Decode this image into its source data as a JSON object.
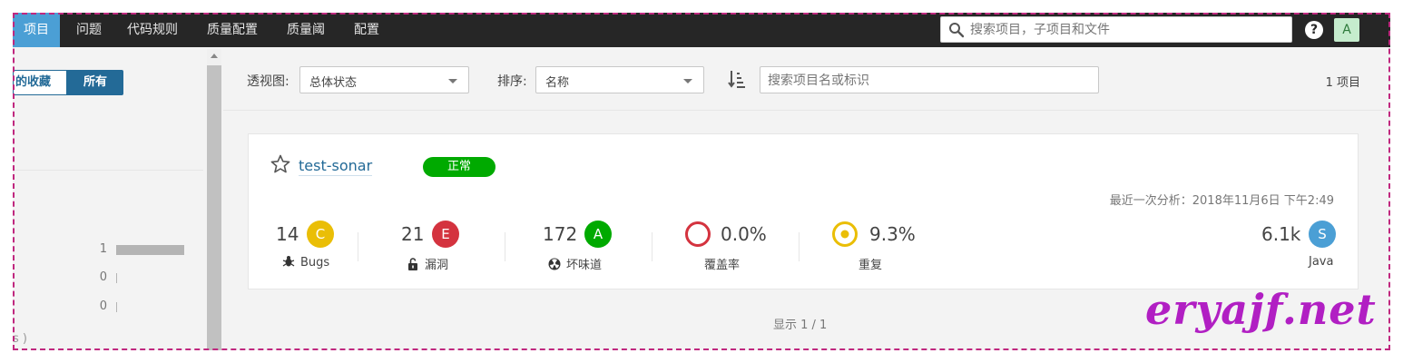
{
  "nav": {
    "items": [
      {
        "label": "项目",
        "active": true
      },
      {
        "label": "问题"
      },
      {
        "label": "代码规则"
      },
      {
        "label": "质量配置"
      },
      {
        "label": "质量阈"
      },
      {
        "label": "配置"
      }
    ],
    "search_placeholder": "搜索项目，子项目和文件",
    "help": "?",
    "avatar": "A"
  },
  "sidebar": {
    "favorites_label": "的收藏",
    "all_label": "所有",
    "facet_counts": [
      "1",
      "0",
      "0"
    ],
    "facet_fill": [
      1,
      0,
      0
    ],
    "cut_text": "s )"
  },
  "toolbar": {
    "perspective_label": "透视图:",
    "perspective_value": "总体状态",
    "sort_label": "排序:",
    "sort_value": "名称",
    "search_placeholder": "搜索项目名或标识",
    "project_count": "1 项目"
  },
  "project": {
    "name": "test-sonar",
    "status": "正常",
    "last_analysis": "最近一次分析：2018年11月6日 下午2:49",
    "bugs": {
      "value": "14",
      "rating": "C",
      "label": "Bugs"
    },
    "vulnerabilities": {
      "value": "21",
      "rating": "E",
      "label": "漏洞"
    },
    "code_smells": {
      "value": "172",
      "rating": "A",
      "label": "坏味道"
    },
    "coverage": {
      "value": "0.0%",
      "label": "覆盖率"
    },
    "duplications": {
      "value": "9.3%",
      "label": "重复"
    },
    "size": {
      "value": "6.1k",
      "badge": "S",
      "label": "Java"
    }
  },
  "colors": {
    "rating_C": "#eabe06",
    "rating_E": "#d4333f",
    "rating_A": "#00aa00",
    "size_badge": "#4b9fd5",
    "status_ok": "#00aa00",
    "nav_active": "#4b9fd5",
    "watermark": "#b11fc3"
  },
  "footer": "显示 1 / 1",
  "watermark": "eryajf.net"
}
